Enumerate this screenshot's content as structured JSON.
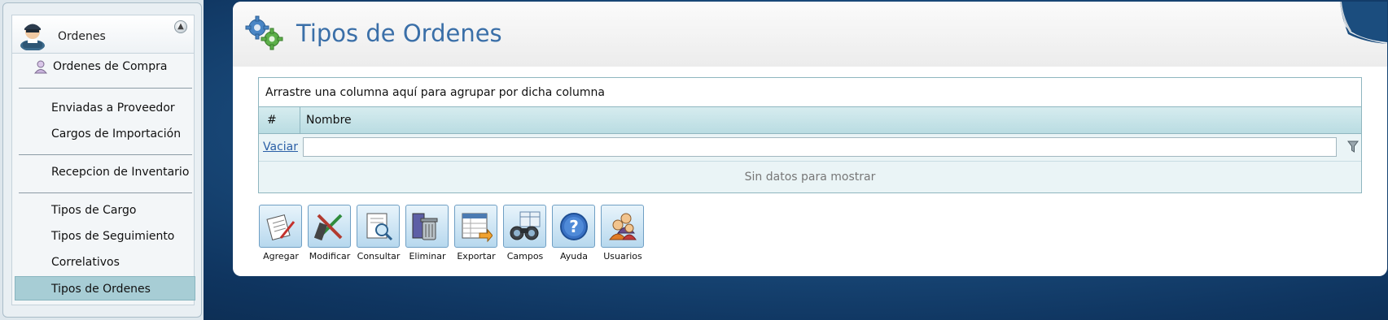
{
  "sidebar": {
    "header_title": "Ordenes",
    "items": [
      {
        "label": "Ordenes de Compra",
        "icon": "user-icon"
      },
      {
        "label": "Enviadas a Proveedor"
      },
      {
        "label": "Cargos de Importación"
      },
      {
        "label": "Recepcion de Inventario"
      },
      {
        "label": "Tipos de Cargo"
      },
      {
        "label": "Tipos de Seguimiento"
      },
      {
        "label": "Correlativos"
      },
      {
        "label": "Tipos de Ordenes",
        "selected": true
      }
    ]
  },
  "page": {
    "title": "Tipos de Ordenes"
  },
  "grid": {
    "group_hint": "Arrastre una columna aquí para agrupar por dicha columna",
    "columns": [
      "#",
      "Nombre"
    ],
    "clear_label": "Vaciar",
    "filter_value": "",
    "empty_text": "Sin datos para mostrar"
  },
  "toolbar": {
    "buttons": [
      {
        "label": "Agregar",
        "icon": "add-document-icon"
      },
      {
        "label": "Modificar",
        "icon": "edit-pencil-icon"
      },
      {
        "label": "Consultar",
        "icon": "search-document-icon"
      },
      {
        "label": "Eliminar",
        "icon": "trash-icon"
      },
      {
        "label": "Exportar",
        "icon": "export-sheet-icon"
      },
      {
        "label": "Campos",
        "icon": "binoculars-icon"
      },
      {
        "label": "Ayuda",
        "icon": "help-icon"
      },
      {
        "label": "Usuarios",
        "icon": "users-icon"
      }
    ]
  },
  "colors": {
    "title": "#3a6fa8",
    "selected_item": "#a7cdd5",
    "grid_header": "#b9dce2"
  }
}
